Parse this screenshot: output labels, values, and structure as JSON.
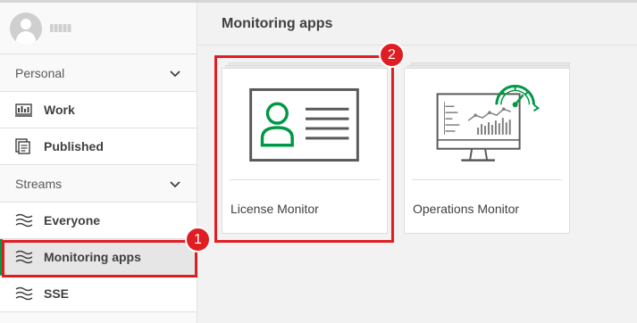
{
  "user": {
    "icon": "avatar-icon"
  },
  "sidebar": {
    "personal": {
      "label": "Personal",
      "items": [
        {
          "label": "Work",
          "icon": "work-icon"
        },
        {
          "label": "Published",
          "icon": "published-icon"
        }
      ]
    },
    "streams": {
      "label": "Streams",
      "items": [
        {
          "label": "Everyone",
          "icon": "stream-icon"
        },
        {
          "label": "Monitoring apps",
          "icon": "stream-icon",
          "active": true
        },
        {
          "label": "SSE",
          "icon": "stream-icon"
        }
      ]
    }
  },
  "main": {
    "title": "Monitoring apps",
    "apps": [
      {
        "name": "License Monitor",
        "icon": "license-monitor-thumbnail"
      },
      {
        "name": "Operations Monitor",
        "icon": "operations-monitor-thumbnail"
      }
    ]
  },
  "annotations": {
    "badge1": "1",
    "badge2": "2",
    "color": "#e11d24"
  },
  "colors": {
    "accent": "#009845"
  }
}
